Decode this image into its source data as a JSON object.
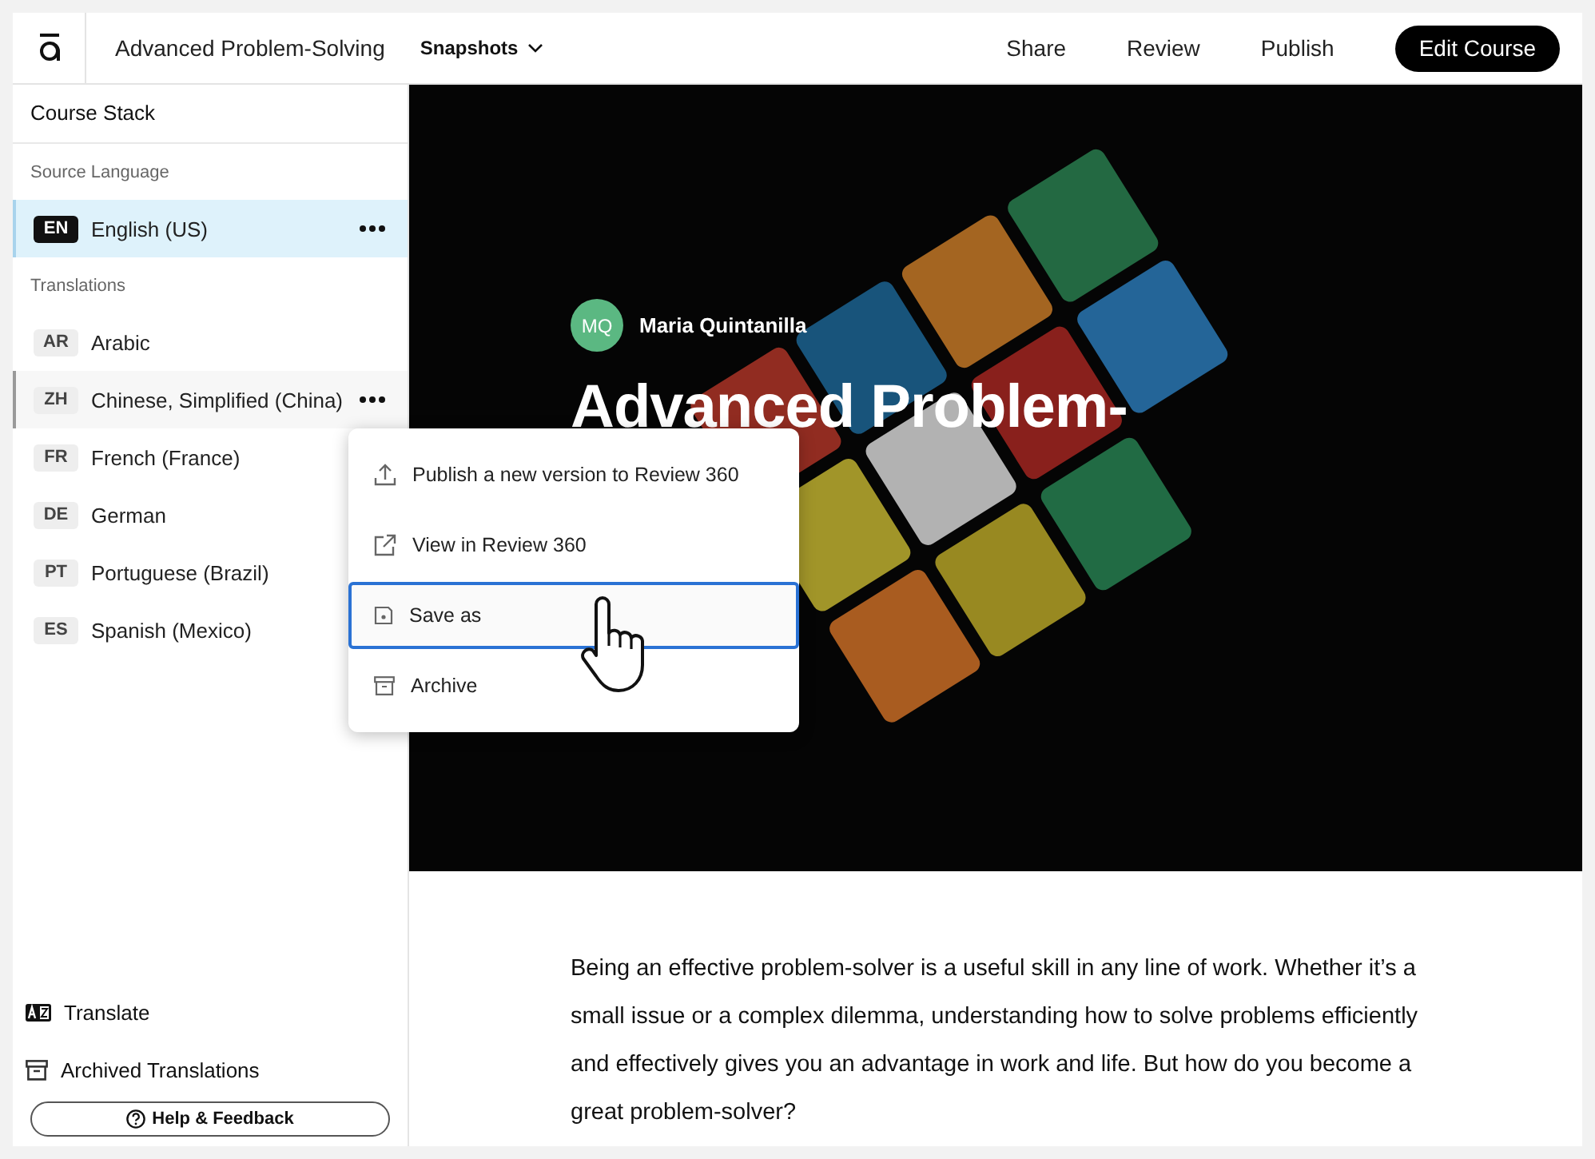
{
  "header": {
    "course_title": "Advanced Problem-Solving",
    "snapshots": "Snapshots",
    "actions": [
      "Share",
      "Review",
      "Publish"
    ],
    "primary_button": "Edit Course"
  },
  "sidebar": {
    "title": "Course Stack",
    "source_heading": "Source Language",
    "source": [
      {
        "code": "EN",
        "name": "English (US)",
        "selected": true
      }
    ],
    "translations_heading": "Translations",
    "translations": [
      {
        "code": "AR",
        "name": "Arabic",
        "menu_open": false
      },
      {
        "code": "ZH",
        "name": "Chinese, Simplified (China)",
        "menu_open": true
      },
      {
        "code": "FR",
        "name": "French (France)",
        "menu_open": false
      },
      {
        "code": "DE",
        "name": "German",
        "menu_open": false
      },
      {
        "code": "PT",
        "name": "Portuguese (Brazil)",
        "menu_open": false
      },
      {
        "code": "ES",
        "name": "Spanish (Mexico)",
        "menu_open": false
      }
    ],
    "footer_links": [
      {
        "kind": "translate",
        "label": "Translate"
      },
      {
        "kind": "archive",
        "label": "Archived Translations"
      }
    ],
    "help_button": "Help & Feedback"
  },
  "context_menu": [
    {
      "kind": "upload",
      "label": "Publish a new version to Review 360",
      "focused": false
    },
    {
      "kind": "external",
      "label": "View in Review 360",
      "focused": false
    },
    {
      "kind": "save",
      "label": "Save as",
      "focused": true
    },
    {
      "kind": "archive",
      "label": "Archive",
      "focused": false
    }
  ],
  "hero": {
    "author_initials": "MQ",
    "author_name": "Maria Quintanilla",
    "title": "Advanced Problem-"
  },
  "body_text": "Being an effective problem-solver is a useful skill in any line of work. Whether it’s a small issue or a complex dilemma, understanding how to solve problems efficiently and effectively gives you an advantage in work and life. But how do you become a great problem-solver?"
}
